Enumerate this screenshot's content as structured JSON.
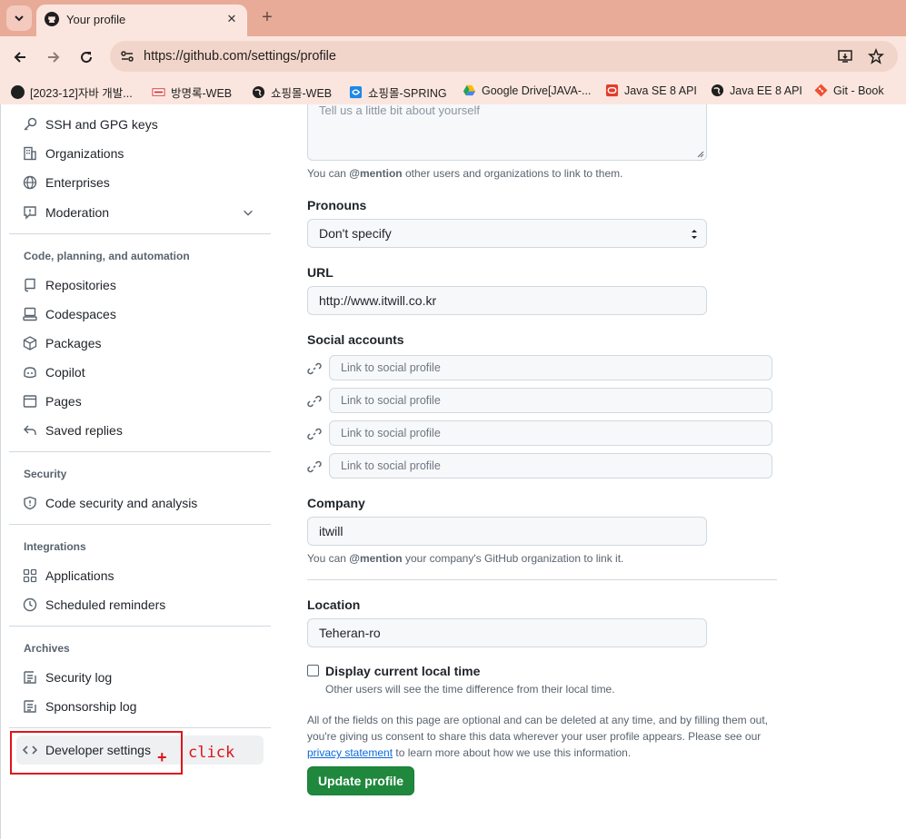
{
  "browser": {
    "tab_title": "Your profile",
    "url": "https://github.com/settings/profile",
    "bookmarks": [
      {
        "label": "[2023-12]자바 개발...",
        "icon": "github-icon"
      },
      {
        "label": "방명록-WEB",
        "icon": "site-icon"
      },
      {
        "label": "쇼핑몰-WEB",
        "icon": "globe-icon"
      },
      {
        "label": "쇼핑몰-SPRING",
        "icon": "site-icon"
      },
      {
        "label": "Google Drive[JAVA-...",
        "icon": "google-drive-icon"
      },
      {
        "label": "Java SE 8 API",
        "icon": "oracle-icon"
      },
      {
        "label": "Java EE 8 API",
        "icon": "globe-icon"
      },
      {
        "label": "Git - Book",
        "icon": "git-icon"
      }
    ]
  },
  "sidebar": {
    "items_top": [
      {
        "label": "SSH and GPG keys",
        "icon": "key-icon"
      },
      {
        "label": "Organizations",
        "icon": "organization-icon"
      },
      {
        "label": "Enterprises",
        "icon": "globe-icon"
      },
      {
        "label": "Moderation",
        "icon": "report-icon"
      }
    ],
    "section_code": {
      "heading": "Code, planning, and automation",
      "items": [
        {
          "label": "Repositories",
          "icon": "repo-icon"
        },
        {
          "label": "Codespaces",
          "icon": "codespaces-icon"
        },
        {
          "label": "Packages",
          "icon": "package-icon"
        },
        {
          "label": "Copilot",
          "icon": "copilot-icon"
        },
        {
          "label": "Pages",
          "icon": "browser-icon"
        },
        {
          "label": "Saved replies",
          "icon": "reply-icon"
        }
      ]
    },
    "section_security": {
      "heading": "Security",
      "items": [
        {
          "label": "Code security and analysis",
          "icon": "shield-icon"
        }
      ]
    },
    "section_integrations": {
      "heading": "Integrations",
      "items": [
        {
          "label": "Applications",
          "icon": "apps-icon"
        },
        {
          "label": "Scheduled reminders",
          "icon": "clock-icon"
        }
      ]
    },
    "section_archives": {
      "heading": "Archives",
      "items": [
        {
          "label": "Security log",
          "icon": "log-icon"
        },
        {
          "label": "Sponsorship log",
          "icon": "log-icon"
        }
      ]
    },
    "developer_settings": "Developer settings",
    "annotation": {
      "plus": "+",
      "text": "click",
      "color": "#e0141a"
    }
  },
  "form": {
    "bio_placeholder": "Tell us a little bit about yourself",
    "bio_note_prefix": "You can ",
    "bio_note_mention": "@mention",
    "bio_note_suffix": " other users and organizations to link to them.",
    "pronouns_label": "Pronouns",
    "pronouns_value": "Don't specify",
    "url_label": "URL",
    "url_value": "http://www.itwill.co.kr",
    "social_label": "Social accounts",
    "social_placeholder": "Link to social profile",
    "company_label": "Company",
    "company_value": "itwill",
    "company_note_prefix": "You can ",
    "company_note_mention": "@mention",
    "company_note_suffix": " your company's GitHub organization to link it.",
    "location_label": "Location",
    "location_value": "Teheran-ro",
    "local_time_label": "Display current local time",
    "local_time_note": "Other users will see the time difference from their local time.",
    "legal_prefix": "All of the fields on this page are optional and can be deleted at any time, and by filling them out, you're giving us consent to share this data wherever your user profile appears. Please see our ",
    "legal_link": "privacy statement",
    "legal_suffix": " to learn more about how we use this information.",
    "update_button": "Update profile",
    "accent_color": "#1f883d"
  }
}
